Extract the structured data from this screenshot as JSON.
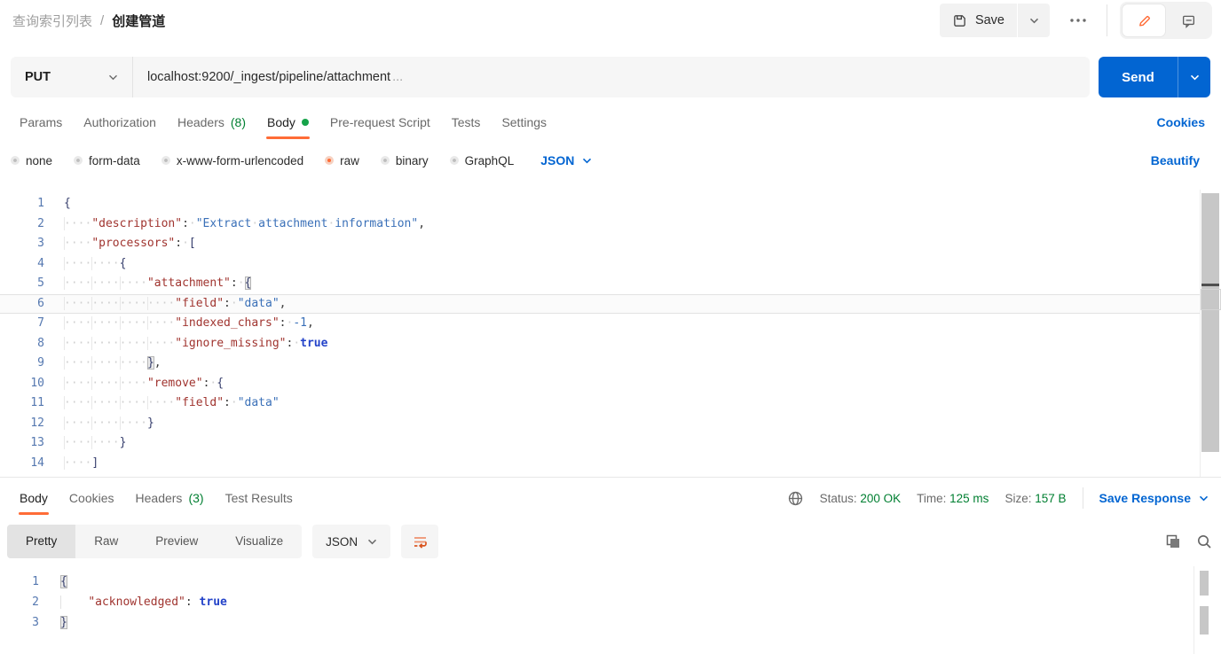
{
  "colors": {
    "accent_orange": "#ff6c37",
    "link_blue": "#0265d2",
    "ok_green": "#007f31",
    "dot_green": "#16a34a"
  },
  "header": {
    "breadcrumb": {
      "parent": "查询索引列表",
      "separator": "/",
      "current": "创建管道"
    },
    "save_label": "Save",
    "icons": {
      "save": "floppy-disk",
      "save_caret": "chevron-down",
      "more": "ellipsis",
      "edit": "pencil",
      "comment": "speech-bubble"
    }
  },
  "request": {
    "method": "PUT",
    "url": "localhost:9200/_ingest/pipeline/attachment",
    "url_ellipsis": "...",
    "send_label": "Send",
    "cookies_link": "Cookies",
    "beautify_link": "Beautify",
    "tabs": [
      {
        "label": "Params"
      },
      {
        "label": "Authorization"
      },
      {
        "label": "Headers",
        "count": "(8)"
      },
      {
        "label": "Body",
        "active": true,
        "dot": true
      },
      {
        "label": "Pre-request Script"
      },
      {
        "label": "Tests"
      },
      {
        "label": "Settings"
      }
    ],
    "body_modes": [
      "none",
      "form-data",
      "x-www-form-urlencoded",
      "raw",
      "binary",
      "GraphQL"
    ],
    "selected_mode": "raw",
    "language": "JSON"
  },
  "editor": {
    "dots": true,
    "lines": [
      {
        "t": [
          [
            "b",
            "{"
          ]
        ]
      },
      {
        "t": [
          [
            "i",
            4
          ],
          [
            "k",
            "\"description\""
          ],
          [
            "p",
            ":"
          ],
          [
            "w",
            1
          ],
          [
            "s",
            "\"Extract"
          ],
          [
            "w",
            1
          ],
          [
            "s",
            "attachment"
          ],
          [
            "w",
            1
          ],
          [
            "s",
            "information\""
          ],
          [
            "p",
            ","
          ]
        ]
      },
      {
        "t": [
          [
            "i",
            4
          ],
          [
            "k",
            "\"processors\""
          ],
          [
            "p",
            ":"
          ],
          [
            "w",
            1
          ],
          [
            "b",
            "["
          ]
        ]
      },
      {
        "t": [
          [
            "i",
            8
          ],
          [
            "b",
            "{"
          ]
        ]
      },
      {
        "t": [
          [
            "i",
            12
          ],
          [
            "k",
            "\"attachment\""
          ],
          [
            "p",
            ":"
          ],
          [
            "w",
            1
          ],
          [
            "hb",
            "{"
          ]
        ]
      },
      {
        "a": true,
        "t": [
          [
            "i",
            16
          ],
          [
            "k",
            "\"field\""
          ],
          [
            "p",
            ":"
          ],
          [
            "w",
            1
          ],
          [
            "s",
            "\"data\""
          ],
          [
            "p",
            ","
          ]
        ]
      },
      {
        "t": [
          [
            "i",
            16
          ],
          [
            "k",
            "\"indexed_chars\""
          ],
          [
            "p",
            ":"
          ],
          [
            "w",
            1
          ],
          [
            "n",
            "-1"
          ],
          [
            "p",
            ","
          ]
        ]
      },
      {
        "t": [
          [
            "i",
            16
          ],
          [
            "k",
            "\"ignore_missing\""
          ],
          [
            "p",
            ":"
          ],
          [
            "w",
            1
          ],
          [
            "bool",
            "true"
          ]
        ]
      },
      {
        "t": [
          [
            "i",
            12
          ],
          [
            "hb",
            "}"
          ],
          [
            "p",
            ","
          ]
        ]
      },
      {
        "t": [
          [
            "i",
            12
          ],
          [
            "k",
            "\"remove\""
          ],
          [
            "p",
            ":"
          ],
          [
            "w",
            1
          ],
          [
            "b",
            "{"
          ]
        ]
      },
      {
        "t": [
          [
            "i",
            16
          ],
          [
            "k",
            "\"field\""
          ],
          [
            "p",
            ":"
          ],
          [
            "w",
            1
          ],
          [
            "s",
            "\"data\""
          ]
        ]
      },
      {
        "t": [
          [
            "i",
            12
          ],
          [
            "b",
            "}"
          ]
        ]
      },
      {
        "t": [
          [
            "i",
            8
          ],
          [
            "b",
            "}"
          ]
        ]
      },
      {
        "t": [
          [
            "i",
            4
          ],
          [
            "b",
            "]"
          ]
        ]
      }
    ]
  },
  "response": {
    "tabs": [
      {
        "label": "Body",
        "active": true
      },
      {
        "label": "Cookies"
      },
      {
        "label": "Headers",
        "count": "(3)"
      },
      {
        "label": "Test Results"
      }
    ],
    "status_label": "Status:",
    "status_value": "200 OK",
    "time_label": "Time:",
    "time_value": "125 ms",
    "size_label": "Size:",
    "size_value": "157 B",
    "save_response_label": "Save Response",
    "view_tabs": [
      "Pretty",
      "Raw",
      "Preview",
      "Visualize"
    ],
    "active_view": "Pretty",
    "language": "JSON",
    "icons": {
      "network": "globe",
      "wrap": "word-wrap",
      "copy": "copy",
      "search": "magnifier"
    },
    "body": {
      "dots": false,
      "lines": [
        {
          "t": [
            [
              "hb",
              "{"
            ]
          ]
        },
        {
          "t": [
            [
              "i",
              4
            ],
            [
              "k",
              "\"acknowledged\""
            ],
            [
              "p",
              ":"
            ],
            [
              "w",
              1
            ],
            [
              "bool",
              "true"
            ]
          ]
        },
        {
          "t": [
            [
              "hb",
              "}"
            ]
          ]
        }
      ]
    }
  }
}
